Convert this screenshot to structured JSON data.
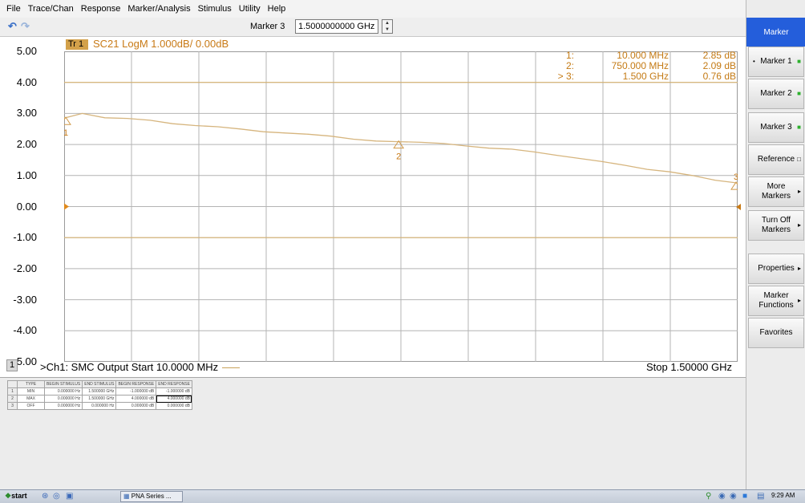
{
  "menu": [
    "File",
    "Trace/Chan",
    "Response",
    "Marker/Analysis",
    "Stimulus",
    "Utility",
    "Help"
  ],
  "toolbar": {
    "undo_icon": "undo-icon",
    "redo_icon": "redo-icon",
    "marker_label": "Marker 3",
    "marker_value": "1.5000000000 GHz"
  },
  "softkeys": {
    "title": "Marker",
    "items": [
      {
        "label": "Marker 1",
        "indicator": "green"
      },
      {
        "label": "Marker 2",
        "indicator": "green"
      },
      {
        "label": "Marker 3",
        "indicator": "green"
      },
      {
        "label": "Reference",
        "indicator": "box"
      },
      {
        "label": "More Markers",
        "indicator": "arrow"
      },
      {
        "label": "Turn Off Markers",
        "indicator": "arrow"
      },
      {
        "label": "Properties",
        "indicator": "arrow"
      },
      {
        "label": "Marker Functions",
        "indicator": "arrow"
      },
      {
        "label": "Favorites",
        "indicator": ""
      }
    ]
  },
  "trace": {
    "tab": "Tr 1",
    "title": "SC21 LogM 1.000dB/ 0.00dB",
    "channel_index": "1",
    "start": ">Ch1: SMC Output Start  10.0000 MHz",
    "stop": "Stop  1.50000 GHz"
  },
  "markers": [
    {
      "id": "1:",
      "freq": "10.000 MHz",
      "value": "2.85 dB",
      "active": false
    },
    {
      "id": "2:",
      "freq": "750.000 MHz",
      "value": "2.09 dB",
      "active": false
    },
    {
      "id": "> 3:",
      "freq": "1.500 GHz",
      "value": "0.76 dB",
      "active": true
    }
  ],
  "limit_table": {
    "headers": [
      "",
      "TYPE",
      "BEGIN STIMULUS",
      "END STIMULUS",
      "BEGIN RESPONSE",
      "END RESPONSE"
    ],
    "rows": [
      [
        "1",
        "MIN",
        "0.000000 Hz",
        "1.500000 GHz",
        "-1.000000 dB",
        "-1.000000 dB"
      ],
      [
        "2",
        "MAX",
        "0.000000 Hz",
        "1.500000 GHz",
        "4.000000 dB",
        "4.000000 dB"
      ],
      [
        "3",
        "OFF",
        "0.000000 Hz",
        "0.000000 Hz",
        "0.000000 dB",
        "0.000000 dB"
      ]
    ]
  },
  "taskbar": {
    "start": "start",
    "task": "PNA Series ...",
    "clock": "9:29 AM"
  },
  "chart_data": {
    "type": "line",
    "title": "SC21 LogM 1.000dB/ 0.00dB",
    "xlabel": "",
    "ylabel": "",
    "xlim": [
      0.01,
      1.5
    ],
    "x_unit": "GHz",
    "ylim": [
      -5.0,
      5.0
    ],
    "yticks": [
      "5.00",
      "4.00",
      "3.00",
      "2.00",
      "1.00",
      "0.00",
      "-1.00",
      "-2.00",
      "-3.00",
      "-4.00",
      "-5.00"
    ],
    "grid": true,
    "reference_level": 0.0,
    "limit_lines": [
      {
        "name": "MAX",
        "value": 4.0
      },
      {
        "name": "MIN",
        "value": -1.0
      }
    ],
    "series": [
      {
        "x": [
          0.01,
          0.05,
          0.1,
          0.15,
          0.2,
          0.25,
          0.3,
          0.35,
          0.4,
          0.45,
          0.5,
          0.55,
          0.6,
          0.65,
          0.7,
          0.75,
          0.8,
          0.85,
          0.9,
          0.95,
          1.0,
          1.05,
          1.1,
          1.15,
          1.2,
          1.25,
          1.3,
          1.35,
          1.4,
          1.45,
          1.5
        ],
        "values": [
          2.85,
          3.0,
          2.86,
          2.84,
          2.78,
          2.67,
          2.61,
          2.57,
          2.5,
          2.41,
          2.37,
          2.33,
          2.27,
          2.17,
          2.11,
          2.09,
          2.07,
          2.03,
          1.95,
          1.88,
          1.85,
          1.76,
          1.65,
          1.55,
          1.45,
          1.33,
          1.2,
          1.12,
          1.0,
          0.85,
          0.76
        ]
      }
    ],
    "markers": [
      {
        "label": "1",
        "x": 0.01,
        "y": 2.85
      },
      {
        "label": "2",
        "x": 0.75,
        "y": 2.09
      },
      {
        "label": "3",
        "x": 1.5,
        "y": 0.76
      }
    ]
  }
}
